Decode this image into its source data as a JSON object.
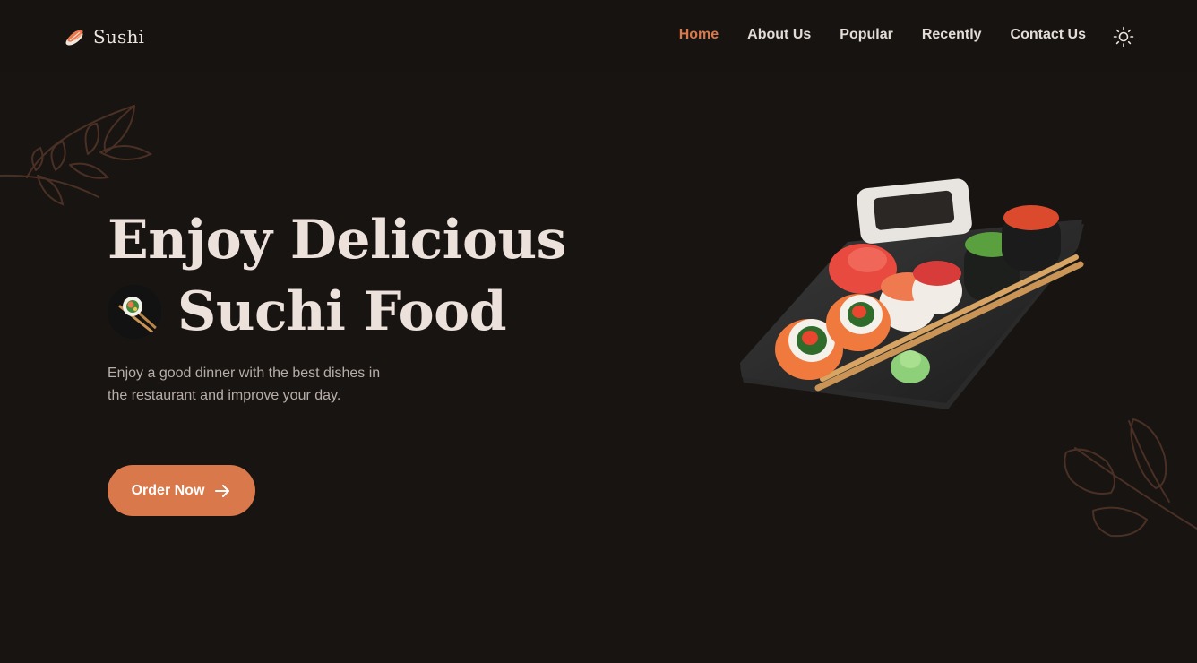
{
  "header": {
    "logo_text": "Sushi",
    "nav": [
      {
        "label": "Home",
        "active": true
      },
      {
        "label": "About Us",
        "active": false
      },
      {
        "label": "Popular",
        "active": false
      },
      {
        "label": "Recently",
        "active": false
      },
      {
        "label": "Contact Us",
        "active": false
      }
    ],
    "theme_toggle_icon": "sun-icon"
  },
  "hero": {
    "title_line1": "Enjoy Delicious",
    "title_line2": "Suchi Food",
    "description": "Enjoy a good dinner with the best dishes in the restaurant and improve your day.",
    "cta_label": "Order Now",
    "cta_icon": "arrow-right-icon"
  },
  "colors": {
    "background": "#181412",
    "accent": "#d9784a",
    "text": "#ece1db",
    "muted_text": "#b8aea8"
  }
}
